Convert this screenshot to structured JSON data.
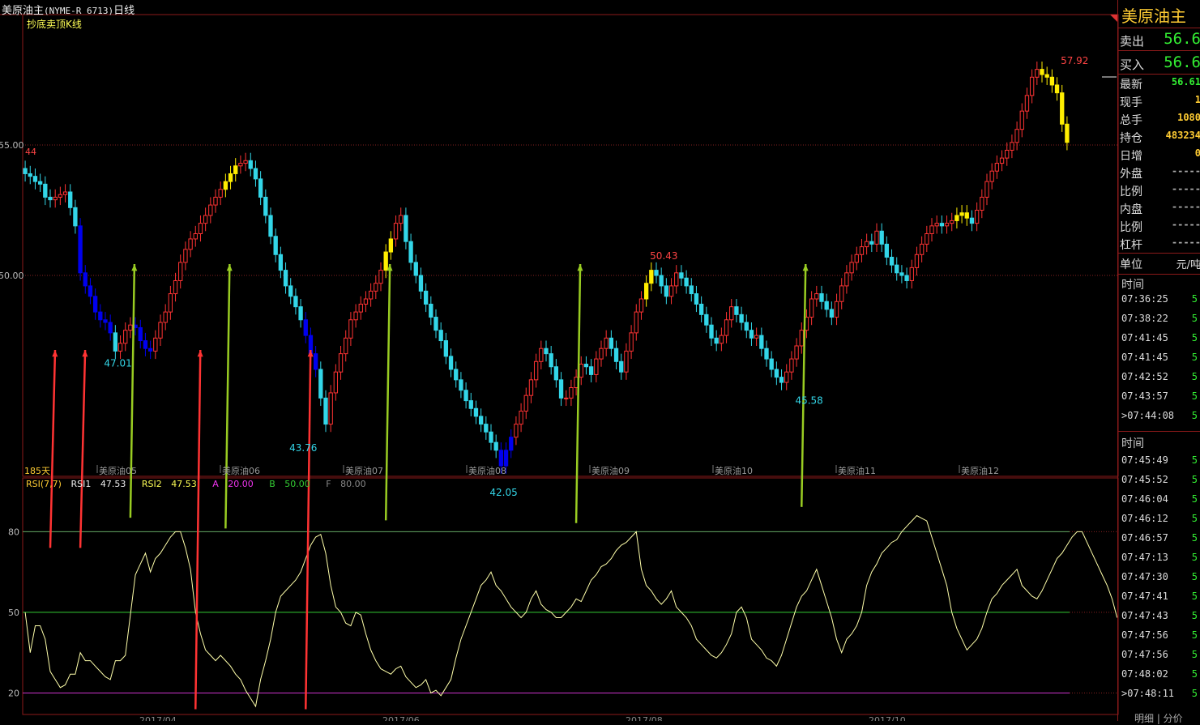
{
  "window": {
    "title": "美原油主",
    "code": "(NYME-R 6713)",
    "period": "日线"
  },
  "indicator_label": "抄底卖顶K线",
  "days_label": "185天",
  "price_axis": {
    "labels": [
      {
        "value": 55,
        "text": "55.00"
      },
      {
        "value": 50,
        "text": "50.00"
      }
    ],
    "left_price_mark": "44"
  },
  "contract_labels": [
    "美原油05",
    "美原油06",
    "美原油07",
    "美原油08",
    "美原油09",
    "美原油10",
    "美原油11",
    "美原油12"
  ],
  "date_labels": [
    "2017/04",
    "2017/06",
    "2017/08",
    "2017/10"
  ],
  "rsi_legend": {
    "name": "RSI(7,7)",
    "rsi1_label": "RSI1",
    "rsi1_value": "47.53",
    "rsi2_label": "RSI2",
    "rsi2_value": "47.53",
    "a_label": "A",
    "a_value": "20.00",
    "b_label": "B",
    "b_value": "50.00",
    "f_label": "F",
    "f_value": "80.00"
  },
  "rsi_axis": {
    "labels": [
      {
        "value": 80,
        "text": "80"
      },
      {
        "value": 50,
        "text": "50"
      },
      {
        "value": 20,
        "text": "20"
      }
    ]
  },
  "colors": {
    "up": "#ff3333",
    "down": "#33d6e8",
    "buy_signal": "#0000ee",
    "sell_signal": "#ffee00",
    "frame": "#8b1a1a",
    "rsi_line": "#ffffaa",
    "band_top": "#66aa66",
    "band_mid": "#33cc33",
    "band_low": "#cc33cc",
    "arrow_buy": "#ff3333",
    "arrow_sell": "#99cc22"
  },
  "chart_data": {
    "type": "candlestick",
    "price_range": [
      42.3,
      60.0
    ],
    "rsi_range": [
      12,
      100
    ],
    "annotations": [
      {
        "text": "47.01",
        "value": 47.01,
        "index": 18
      },
      {
        "text": "43.76",
        "value": 43.76,
        "index": 55
      },
      {
        "text": "42.05",
        "value": 42.05,
        "index": 95
      },
      {
        "text": "50.43",
        "value": 50.43,
        "index": 127
      },
      {
        "text": "45.58",
        "value": 45.58,
        "index": 156
      },
      {
        "text": "57.92",
        "value": 57.92,
        "index": 209
      }
    ],
    "closes": [
      53.9,
      53.8,
      53.6,
      53.5,
      53.0,
      52.9,
      53.0,
      53.1,
      53.2,
      52.6,
      51.9,
      50.1,
      49.6,
      49.2,
      48.6,
      48.3,
      48.2,
      47.8,
      47.1,
      47.4,
      47.9,
      48.1,
      48.0,
      47.5,
      47.2,
      47.1,
      47.6,
      48.2,
      48.6,
      49.3,
      49.8,
      50.5,
      51.0,
      51.4,
      51.6,
      52.0,
      52.3,
      52.7,
      53.0,
      53.3,
      53.6,
      53.9,
      54.2,
      54.3,
      54.4,
      54.1,
      53.7,
      53.0,
      52.3,
      51.5,
      50.8,
      50.2,
      49.6,
      49.2,
      48.8,
      48.3,
      47.7,
      47.0,
      46.4,
      45.3,
      44.3,
      45.5,
      46.3,
      47.0,
      47.6,
      48.3,
      48.6,
      48.9,
      49.1,
      49.4,
      49.7,
      50.2,
      50.9,
      51.4,
      52.0,
      52.3,
      51.3,
      50.5,
      50.0,
      49.4,
      48.9,
      48.4,
      47.9,
      47.5,
      46.9,
      46.4,
      46.0,
      45.6,
      45.2,
      44.9,
      44.6,
      44.3,
      44.0,
      43.6,
      43.3,
      42.7,
      43.3,
      43.8,
      44.3,
      44.8,
      45.4,
      46.0,
      46.7,
      47.2,
      47.0,
      46.5,
      46.0,
      45.3,
      45.3,
      45.7,
      46.1,
      46.6,
      46.5,
      46.2,
      46.8,
      47.2,
      47.6,
      47.2,
      46.7,
      46.3,
      47.1,
      47.8,
      48.6,
      49.1,
      49.7,
      50.2,
      50.0,
      49.6,
      49.2,
      49.6,
      50.1,
      49.9,
      49.6,
      49.3,
      48.9,
      48.5,
      48.1,
      47.6,
      47.4,
      47.7,
      48.3,
      48.8,
      48.5,
      48.2,
      47.9,
      47.6,
      47.7,
      47.2,
      46.8,
      46.4,
      46.1,
      45.9,
      46.3,
      46.8,
      47.3,
      47.9,
      48.4,
      49.1,
      49.3,
      49.0,
      48.7,
      48.4,
      49.0,
      49.6,
      50.1,
      50.5,
      50.8,
      51.1,
      51.3,
      51.2,
      51.7,
      51.2,
      50.7,
      50.4,
      50.1,
      50.0,
      49.8,
      50.3,
      50.8,
      51.2,
      51.6,
      51.9,
      52.0,
      51.9,
      52.0,
      52.1,
      52.3,
      52.4,
      52.2,
      52.0,
      52.5,
      53.0,
      53.6,
      54.0,
      54.3,
      54.5,
      54.8,
      55.1,
      55.6,
      56.3,
      56.9,
      57.6,
      57.9,
      57.7,
      57.6,
      57.3,
      57.0,
      55.8,
      55.1
    ],
    "rsi": [
      50,
      35,
      45,
      45,
      40,
      28,
      25,
      22,
      23,
      27,
      27,
      35,
      32,
      32,
      30,
      28,
      26,
      25,
      32,
      32,
      34,
      49,
      64,
      68,
      72,
      65,
      70,
      72,
      75,
      78,
      80,
      80,
      74,
      66,
      50,
      42,
      36,
      34,
      32,
      34,
      32,
      30,
      27,
      25,
      21,
      18,
      15,
      25,
      32,
      40,
      50,
      56,
      58,
      60,
      62,
      65,
      70,
      75,
      78,
      79,
      72,
      60,
      52,
      50,
      46,
      45,
      50,
      49,
      42,
      36,
      32,
      29,
      28,
      27,
      29,
      30,
      26,
      24,
      22,
      23,
      25,
      20,
      21,
      19,
      22,
      25,
      33,
      40,
      45,
      50,
      55,
      60,
      62,
      65,
      60,
      58,
      55,
      52,
      50,
      48,
      50,
      55,
      58,
      53,
      51,
      50,
      48,
      48,
      50,
      52,
      55,
      54,
      58,
      62,
      64,
      67,
      68,
      70,
      73,
      75,
      76,
      78,
      80,
      66,
      60,
      58,
      55,
      53,
      55,
      58,
      52,
      50,
      48,
      45,
      40,
      38,
      36,
      34,
      33,
      35,
      38,
      42,
      50,
      52,
      48,
      40,
      38,
      36,
      33,
      32,
      30,
      34,
      40,
      46,
      52,
      56,
      58,
      62,
      66,
      60,
      54,
      48,
      40,
      35,
      40,
      42,
      45,
      50,
      60,
      65,
      68,
      72,
      74,
      76,
      77,
      80,
      82,
      84,
      86,
      85,
      84,
      78,
      72,
      66,
      60,
      50,
      44,
      40,
      36,
      38,
      40,
      44,
      50,
      55,
      57,
      60,
      62,
      64,
      66,
      60,
      58,
      56,
      55,
      58,
      62,
      66,
      70,
      72,
      75,
      78,
      80,
      80,
      76,
      72,
      68,
      64,
      60,
      55,
      48
    ],
    "buy_arrows": [
      [
        5,
        60,
        80
      ],
      [
        11,
        59,
        80
      ],
      [
        34,
        57,
        20
      ],
      [
        56,
        56,
        20
      ]
    ],
    "sell_arrows": [
      [
        21,
        30,
        84
      ],
      [
        40,
        34,
        80
      ],
      [
        72,
        58,
        83
      ],
      [
        110,
        44,
        82
      ],
      [
        155,
        41,
        88
      ]
    ]
  }
}
